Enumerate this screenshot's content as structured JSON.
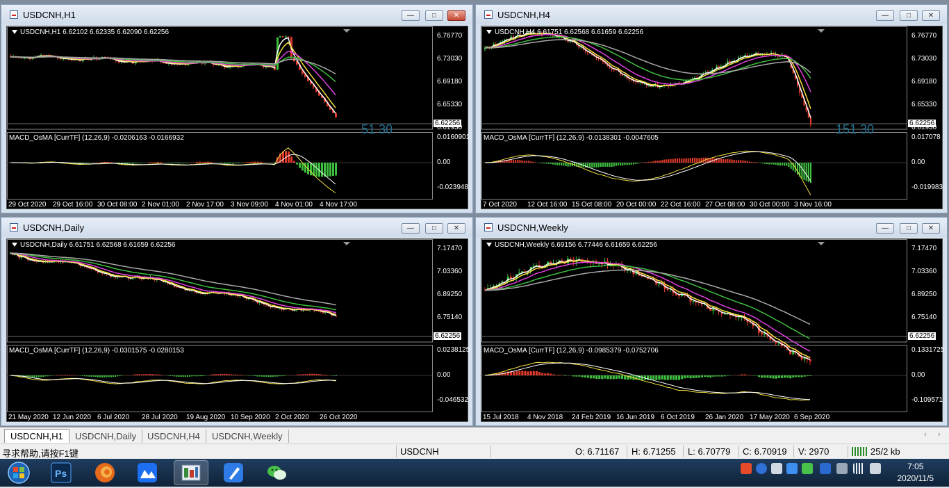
{
  "windows": [
    {
      "title": "USDCNH,H1",
      "ohlc": "USDCNH,H1  6.62102 6.62335 6.62090 6.62256",
      "price_axis": [
        "6.76770",
        "6.73030",
        "6.69180",
        "6.65330",
        "6.62256",
        "6.61930"
      ],
      "last_price": "6.62256",
      "macd_label": "MACD_OsMA [CurrTF] (12,26,9) -0.0206163 -0.0166932",
      "macd_axis": [
        "0.0160901",
        "0.00",
        "-0.023948"
      ],
      "time_axis": [
        "29 Oct 2020",
        "29 Oct 16:00",
        "30 Oct 08:00",
        "2 Nov 01:00",
        "2 Nov 17:00",
        "3 Nov 09:00",
        "4 Nov 01:00",
        "4 Nov 17:00"
      ],
      "watermark": "51 30"
    },
    {
      "title": "USDCNH,H4",
      "ohlc": "USDCNH,H4  6.61751 6.62568 6.61659 6.62256",
      "price_axis": [
        "6.76770",
        "6.73030",
        "6.69180",
        "6.65330",
        "6.62256",
        "6.61930"
      ],
      "last_price": "6.62256",
      "macd_label": "MACD_OsMA [CurrTF] (12,26,9) -0.0138301 -0.0047605",
      "macd_axis": [
        "0.017078",
        "0.00",
        "-0.019983"
      ],
      "time_axis": [
        "7 Oct 2020",
        "12 Oct 16:00",
        "15 Oct 08:00",
        "20 Oct 00:00",
        "22 Oct 16:00",
        "27 Oct 08:00",
        "30 Oct 00:00",
        "3 Nov 16:00"
      ],
      "watermark": "151 30"
    },
    {
      "title": "USDCNH,Daily",
      "ohlc": "USDCNH,Daily  6.61751 6.62568 6.61659 6.62256",
      "price_axis": [
        "7.17470",
        "7.03360",
        "6.89250",
        "6.75140",
        "6.62256"
      ],
      "last_price": "6.62256",
      "macd_label": "MACD_OsMA [CurrTF] (12,26,9) -0.0301575 -0.0280153",
      "macd_axis": [
        "0.0238125",
        "0.00",
        "-0.046532"
      ],
      "time_axis": [
        "21 May 2020",
        "12 Jun 2020",
        "6 Jul 2020",
        "28 Jul 2020",
        "19 Aug 2020",
        "10 Sep 2020",
        "2 Oct 2020",
        "26 Oct 2020"
      ]
    },
    {
      "title": "USDCNH,Weekly",
      "ohlc": "USDCNH,Weekly  6.69156 6.77446 6.61659 6.62256",
      "price_axis": [
        "7.17470",
        "7.03360",
        "6.89250",
        "6.75140",
        "6.62256"
      ],
      "last_price": "6.62256",
      "macd_label": "MACD_OsMA [CurrTF] (12,26,9) -0.0985379 -0.0752706",
      "macd_axis": [
        "0.1331725",
        "0.00",
        "-0.109571"
      ],
      "time_axis": [
        "15 Jul 2018",
        "4 Nov 2018",
        "24 Feb 2019",
        "16 Jun 2019",
        "6 Oct 2019",
        "26 Jan 2020",
        "17 May 2020",
        "6 Sep 2020"
      ]
    }
  ],
  "tabs": [
    "USDCNH,H1",
    "USDCNH,Daily",
    "USDCNH,H4",
    "USDCNH,Weekly"
  ],
  "status": {
    "help": "寻求帮助,请按F1键",
    "symbol": "USDCNH",
    "open": "O: 6.71167",
    "high": "H: 6.71255",
    "low": "L: 6.70779",
    "close": "C: 6.70919",
    "volume": "V: 2970",
    "traffic": "25/2 kb"
  },
  "clock": {
    "time": "7:05",
    "date": "2020/11/5"
  },
  "colors": {
    "up": "#3fbf3f",
    "down": "#e23a2a",
    "ema_fast": "#ffffff",
    "ema_mid": "#f5e142",
    "ema_slow": "#e040e0",
    "sma_green": "#3fbf3f",
    "sma_grey": "#a8a8a8"
  },
  "icons": {
    "taskbar": [
      "windows-start-icon",
      "photoshop-icon",
      "firefox-icon",
      "cloud-app-icon",
      "metatrader-icon",
      "feather-note-icon",
      "wechat-icon"
    ]
  }
}
